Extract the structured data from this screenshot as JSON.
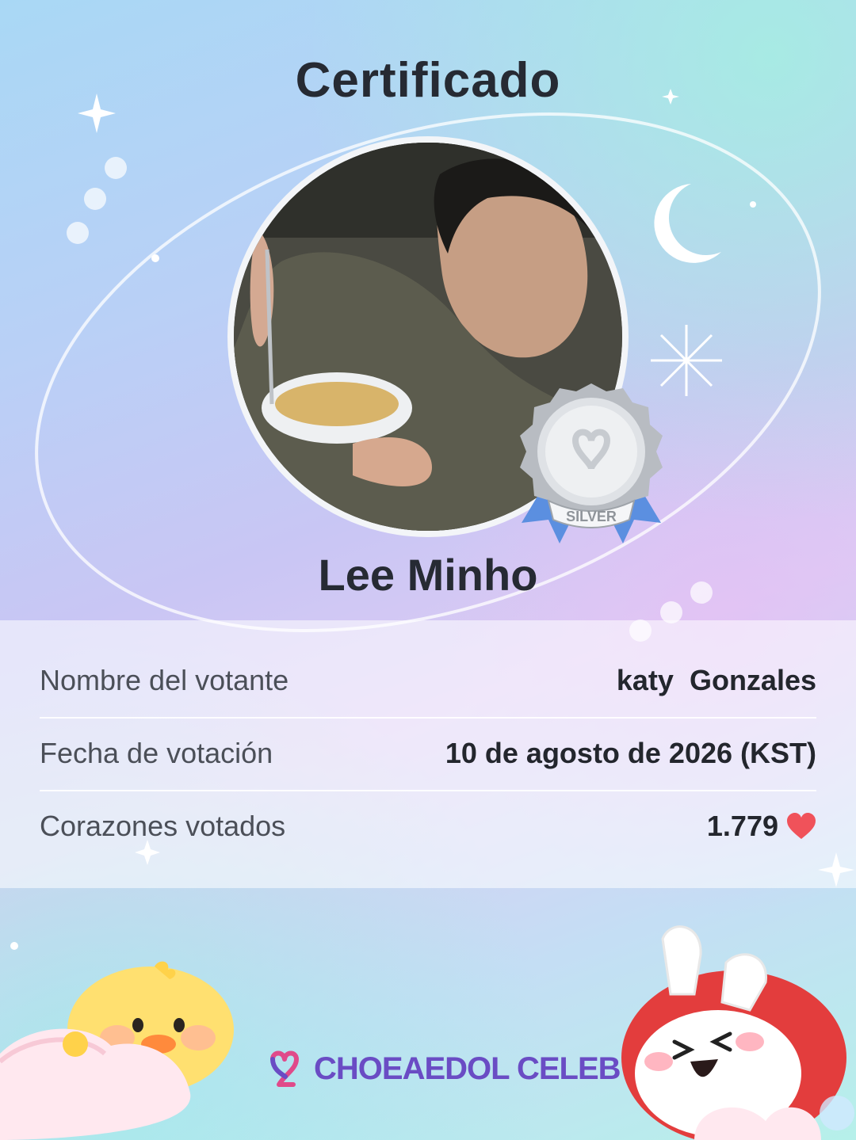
{
  "certificate": {
    "title": "Certificado",
    "celebrity_name": "Lee Minho",
    "badge_label": "SILVER"
  },
  "info": {
    "voter_label": "Nombre del votante",
    "voter_value": "katy  Gonzales",
    "date_label": "Fecha de votación",
    "date_value": "10 de agosto de 2026 (KST)",
    "hearts_label": "Corazones votados",
    "hearts_value": "1.779"
  },
  "brand": {
    "name": "CHOEAEDOL CELEB"
  },
  "colors": {
    "heart": "#f0525a",
    "brand": "#6a4cc4",
    "badge_ribbon": "#5b8fe0"
  },
  "icons": {
    "heart": "heart-icon",
    "badge": "silver-medal-icon",
    "logo": "choeaedol-heart-logo-icon"
  }
}
